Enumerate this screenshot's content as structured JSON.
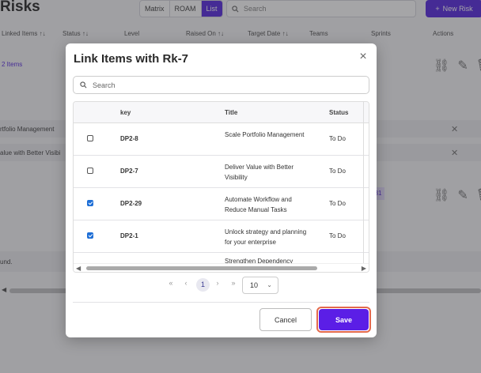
{
  "background": {
    "page_title": "Risks",
    "view_toggle": [
      "Matrix",
      "ROAM",
      "List"
    ],
    "active_view": "List",
    "search_placeholder": "Search",
    "new_risk_label": "New Risk",
    "columns": [
      "Linked Items ↑↓",
      "Status ↑↓",
      "Level",
      "Raised On ↑↓",
      "Target Date ↑↓",
      "Teams",
      "Sprints",
      "Actions"
    ],
    "linked_items_text": "2 Items",
    "rows": [
      "rtfolio Management",
      "alue with Better Visibi",
      "und."
    ],
    "tag_text": "31"
  },
  "modal": {
    "title": "Link Items with Rk-7",
    "search_placeholder": "Search",
    "table": {
      "headers": {
        "key": "key",
        "title": "Title",
        "status": "Status"
      },
      "rows": [
        {
          "key": "DP2-8",
          "title": "Scale Portfolio Management",
          "status": "To Do",
          "checked": false
        },
        {
          "key": "DP2-7",
          "title": "Deliver Value with Better Visibility",
          "status": "To Do",
          "checked": false
        },
        {
          "key": "DP2-29",
          "title": "Automate Workflow and Reduce Manual Tasks",
          "status": "To Do",
          "checked": true
        },
        {
          "key": "DP2-1",
          "title": "Unlock strategy and planning for your enterprise",
          "status": "To Do",
          "checked": true
        },
        {
          "key": "",
          "title": "Strengthen Dependency",
          "status": "",
          "checked": false
        }
      ]
    },
    "pagination": {
      "first": "«",
      "prev": "‹",
      "current_page": "1",
      "next": "›",
      "last": "»",
      "page_size": "10"
    },
    "cancel_label": "Cancel",
    "save_label": "Save"
  },
  "colors": {
    "accent": "#5b1ee6",
    "focus_ring": "#e46a4c",
    "checkbox": "#1f6fd6"
  }
}
